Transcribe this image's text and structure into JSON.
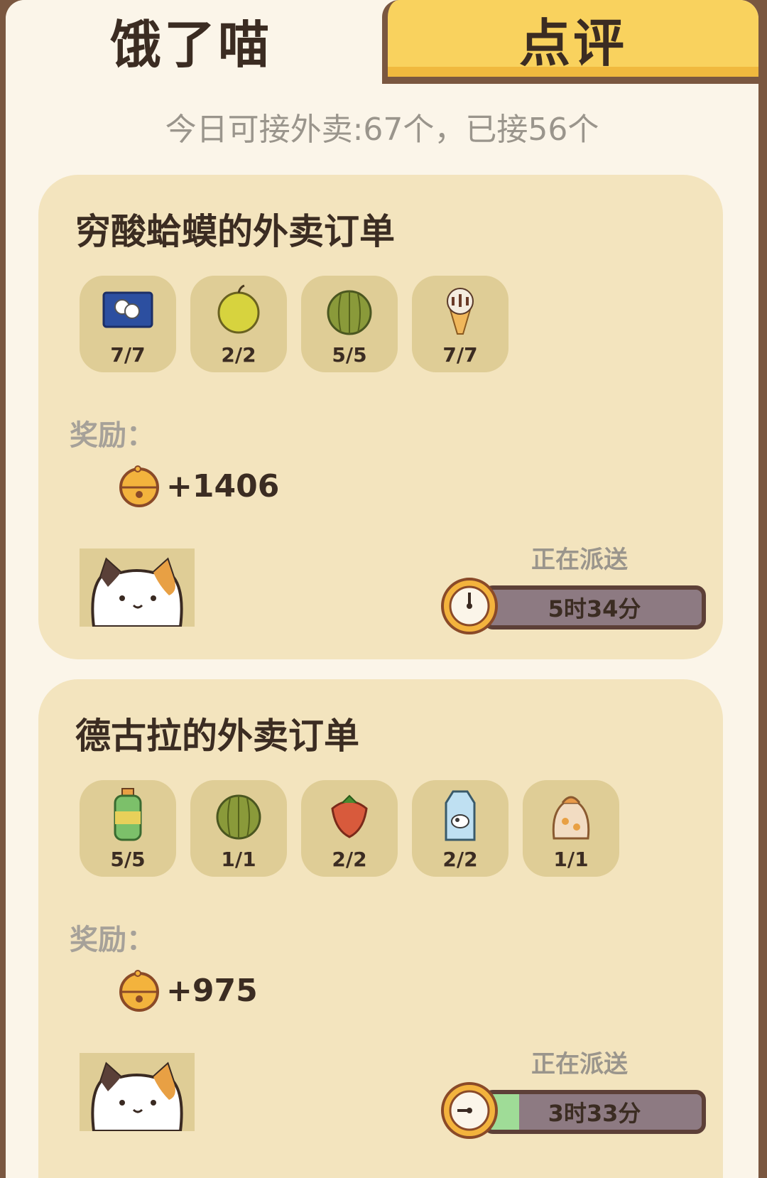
{
  "tabs": {
    "active": "饿了喵",
    "inactive": "点评"
  },
  "summary": "今日可接外卖:67个，已接56个",
  "colors": {
    "card_bg": "#f3e4be",
    "tab_active_bg": "#fbf5e9",
    "tab_inactive_bg": "#f9d25e",
    "progress_fill": "#9fdc97"
  },
  "orders": [
    {
      "title": "穷酸蛤蟆的外卖订单",
      "items": [
        {
          "icon": "dumpling-tray-icon",
          "count": "7/7"
        },
        {
          "icon": "pear-icon",
          "count": "2/2"
        },
        {
          "icon": "melon-icon",
          "count": "5/5"
        },
        {
          "icon": "ice-cream-icon",
          "count": "7/7"
        }
      ],
      "reward_label": "奖励：",
      "reward_icon": "bell-coin-icon",
      "reward_amount": "+1406",
      "avatar_icon": "cat-avatar-icon",
      "status": "正在派送",
      "time_left": "5时34分",
      "progress": 0
    },
    {
      "title": "德古拉的外卖订单",
      "items": [
        {
          "icon": "juice-bottle-icon",
          "count": "5/5"
        },
        {
          "icon": "melon-icon",
          "count": "1/1"
        },
        {
          "icon": "strawberry-icon",
          "count": "2/2"
        },
        {
          "icon": "milk-carton-icon",
          "count": "2/2"
        },
        {
          "icon": "candy-bag-icon",
          "count": "1/1"
        }
      ],
      "reward_label": "奖励：",
      "reward_icon": "bell-coin-icon",
      "reward_amount": "+975",
      "avatar_icon": "cat-avatar-icon",
      "status": "正在派送",
      "time_left": "3时33分",
      "progress": 0.15
    }
  ]
}
